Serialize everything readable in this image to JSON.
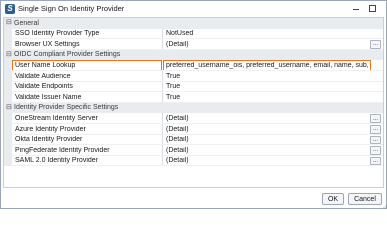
{
  "window": {
    "title": "Single Sign On Identity Provider",
    "ok_label": "OK",
    "cancel_label": "Cancel"
  },
  "grid": {
    "categories": {
      "general": "General",
      "oidc": "OIDC Compliant Provider Settings",
      "idp": "Identity Provider Specific Settings"
    },
    "rows": {
      "sso_type": {
        "name": "SSO Identity Provider Type",
        "value": "NotUsed"
      },
      "browser_ux": {
        "name": "Browser UX Settings",
        "value": "(Detail)"
      },
      "user_name_lookup": {
        "name": "User Name Lookup",
        "value": "preferred_username_ois, preferred_username, email, name, sub, aud"
      },
      "validate_audience": {
        "name": "Validate Audience",
        "value": "True"
      },
      "validate_endpoints": {
        "name": "Validate Endpoints",
        "value": "True"
      },
      "validate_issuer": {
        "name": "Validate Issuer Name",
        "value": "True"
      },
      "onestream": {
        "name": "OneStream Identity Server",
        "value": "(Detail)"
      },
      "azure": {
        "name": "Azure Identity Provider",
        "value": "(Detail)"
      },
      "okta": {
        "name": "Okta Identity Provider",
        "value": "(Detail)"
      },
      "pingfederate": {
        "name": "PingFederate Identity Provider",
        "value": "(Detail)"
      },
      "saml": {
        "name": "SAML 2.0 Identity Provider",
        "value": "(Detail)"
      }
    },
    "ellipsis": "..."
  }
}
